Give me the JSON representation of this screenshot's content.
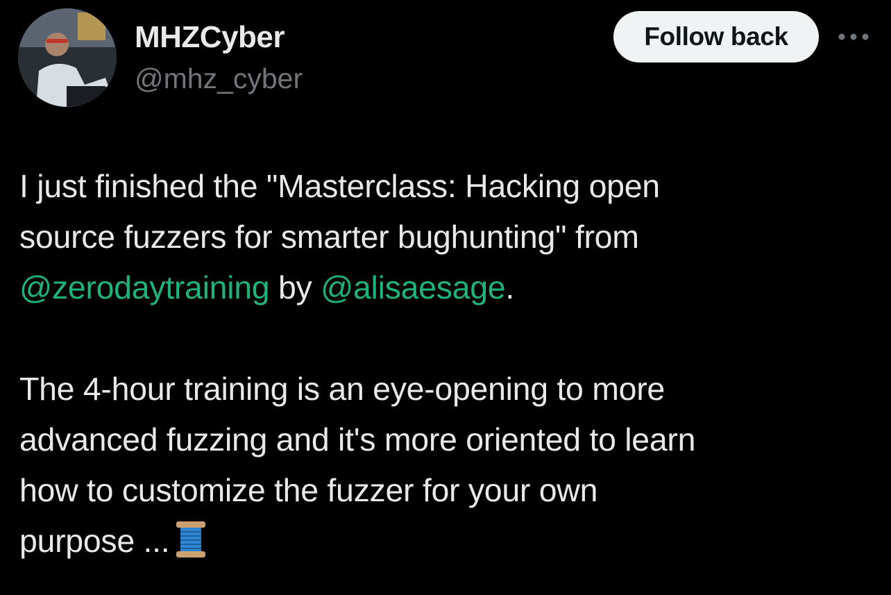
{
  "author": {
    "display_name": "MHZCyber",
    "handle": "@mhz_cyber"
  },
  "actions": {
    "follow_label": "Follow back",
    "more_icon": "more-horizontal-icon"
  },
  "tweet": {
    "p1": {
      "line1": "I just finished the \"Masterclass: Hacking open",
      "line2": "source fuzzers for smarter bughunting\" from",
      "mention1": "@zerodaytraining",
      "by_text": " by ",
      "mention2": "@alisaesage",
      "end_punct": "."
    },
    "p2": {
      "line1": "The 4-hour training is an eye-opening to more",
      "line2": "advanced fuzzing and it's more oriented to learn",
      "line3": "how to customize the fuzzer for your own",
      "line4": "purpose ...",
      "emoji": "spool-of-thread-icon"
    }
  },
  "colors": {
    "background": "#000000",
    "text": "#e7e9ea",
    "secondary_text": "#71767b",
    "mention": "#1fb37a",
    "button_bg": "#eff3f4",
    "button_text": "#0f1419"
  }
}
